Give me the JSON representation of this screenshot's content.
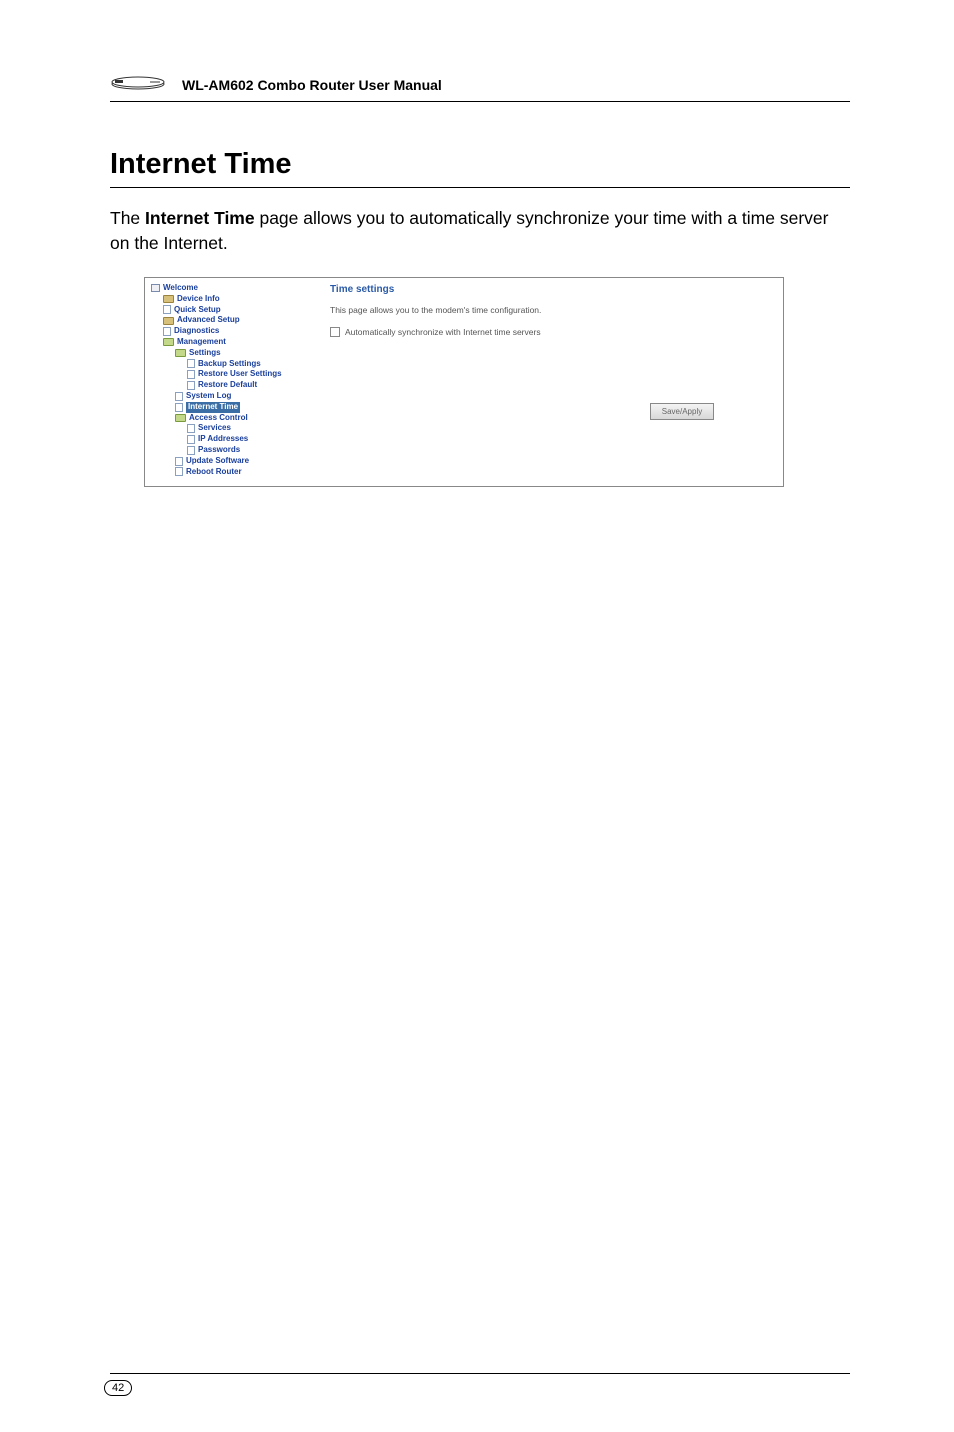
{
  "header": {
    "manual_title": "WL-AM602 Combo Router User Manual"
  },
  "section": {
    "title": "Internet Time",
    "body_prefix": "The ",
    "body_strong": "Internet Time",
    "body_suffix": " page allows you to automatically synchronize your time with a time server on the Internet."
  },
  "tree": {
    "root": "Welcome",
    "device_info": "Device Info",
    "quick_setup": "Quick Setup",
    "advanced_setup": "Advanced Setup",
    "diagnostics": "Diagnostics",
    "management": "Management",
    "settings": "Settings",
    "backup_settings": "Backup Settings",
    "restore_user_settings": "Restore User Settings",
    "restore_default": "Restore Default",
    "system_log": "System Log",
    "internet_time": "Internet Time",
    "access_control": "Access Control",
    "services": "Services",
    "ip_addresses": "IP Addresses",
    "passwords": "Passwords",
    "update_software": "Update Software",
    "reboot_router": "Reboot Router"
  },
  "content": {
    "heading": "Time settings",
    "description": "This page allows you to the modem's time configuration.",
    "checkbox_label": "Automatically synchronize with Internet time servers",
    "apply_button": "Save/Apply"
  },
  "footer": {
    "page_number": "42"
  }
}
